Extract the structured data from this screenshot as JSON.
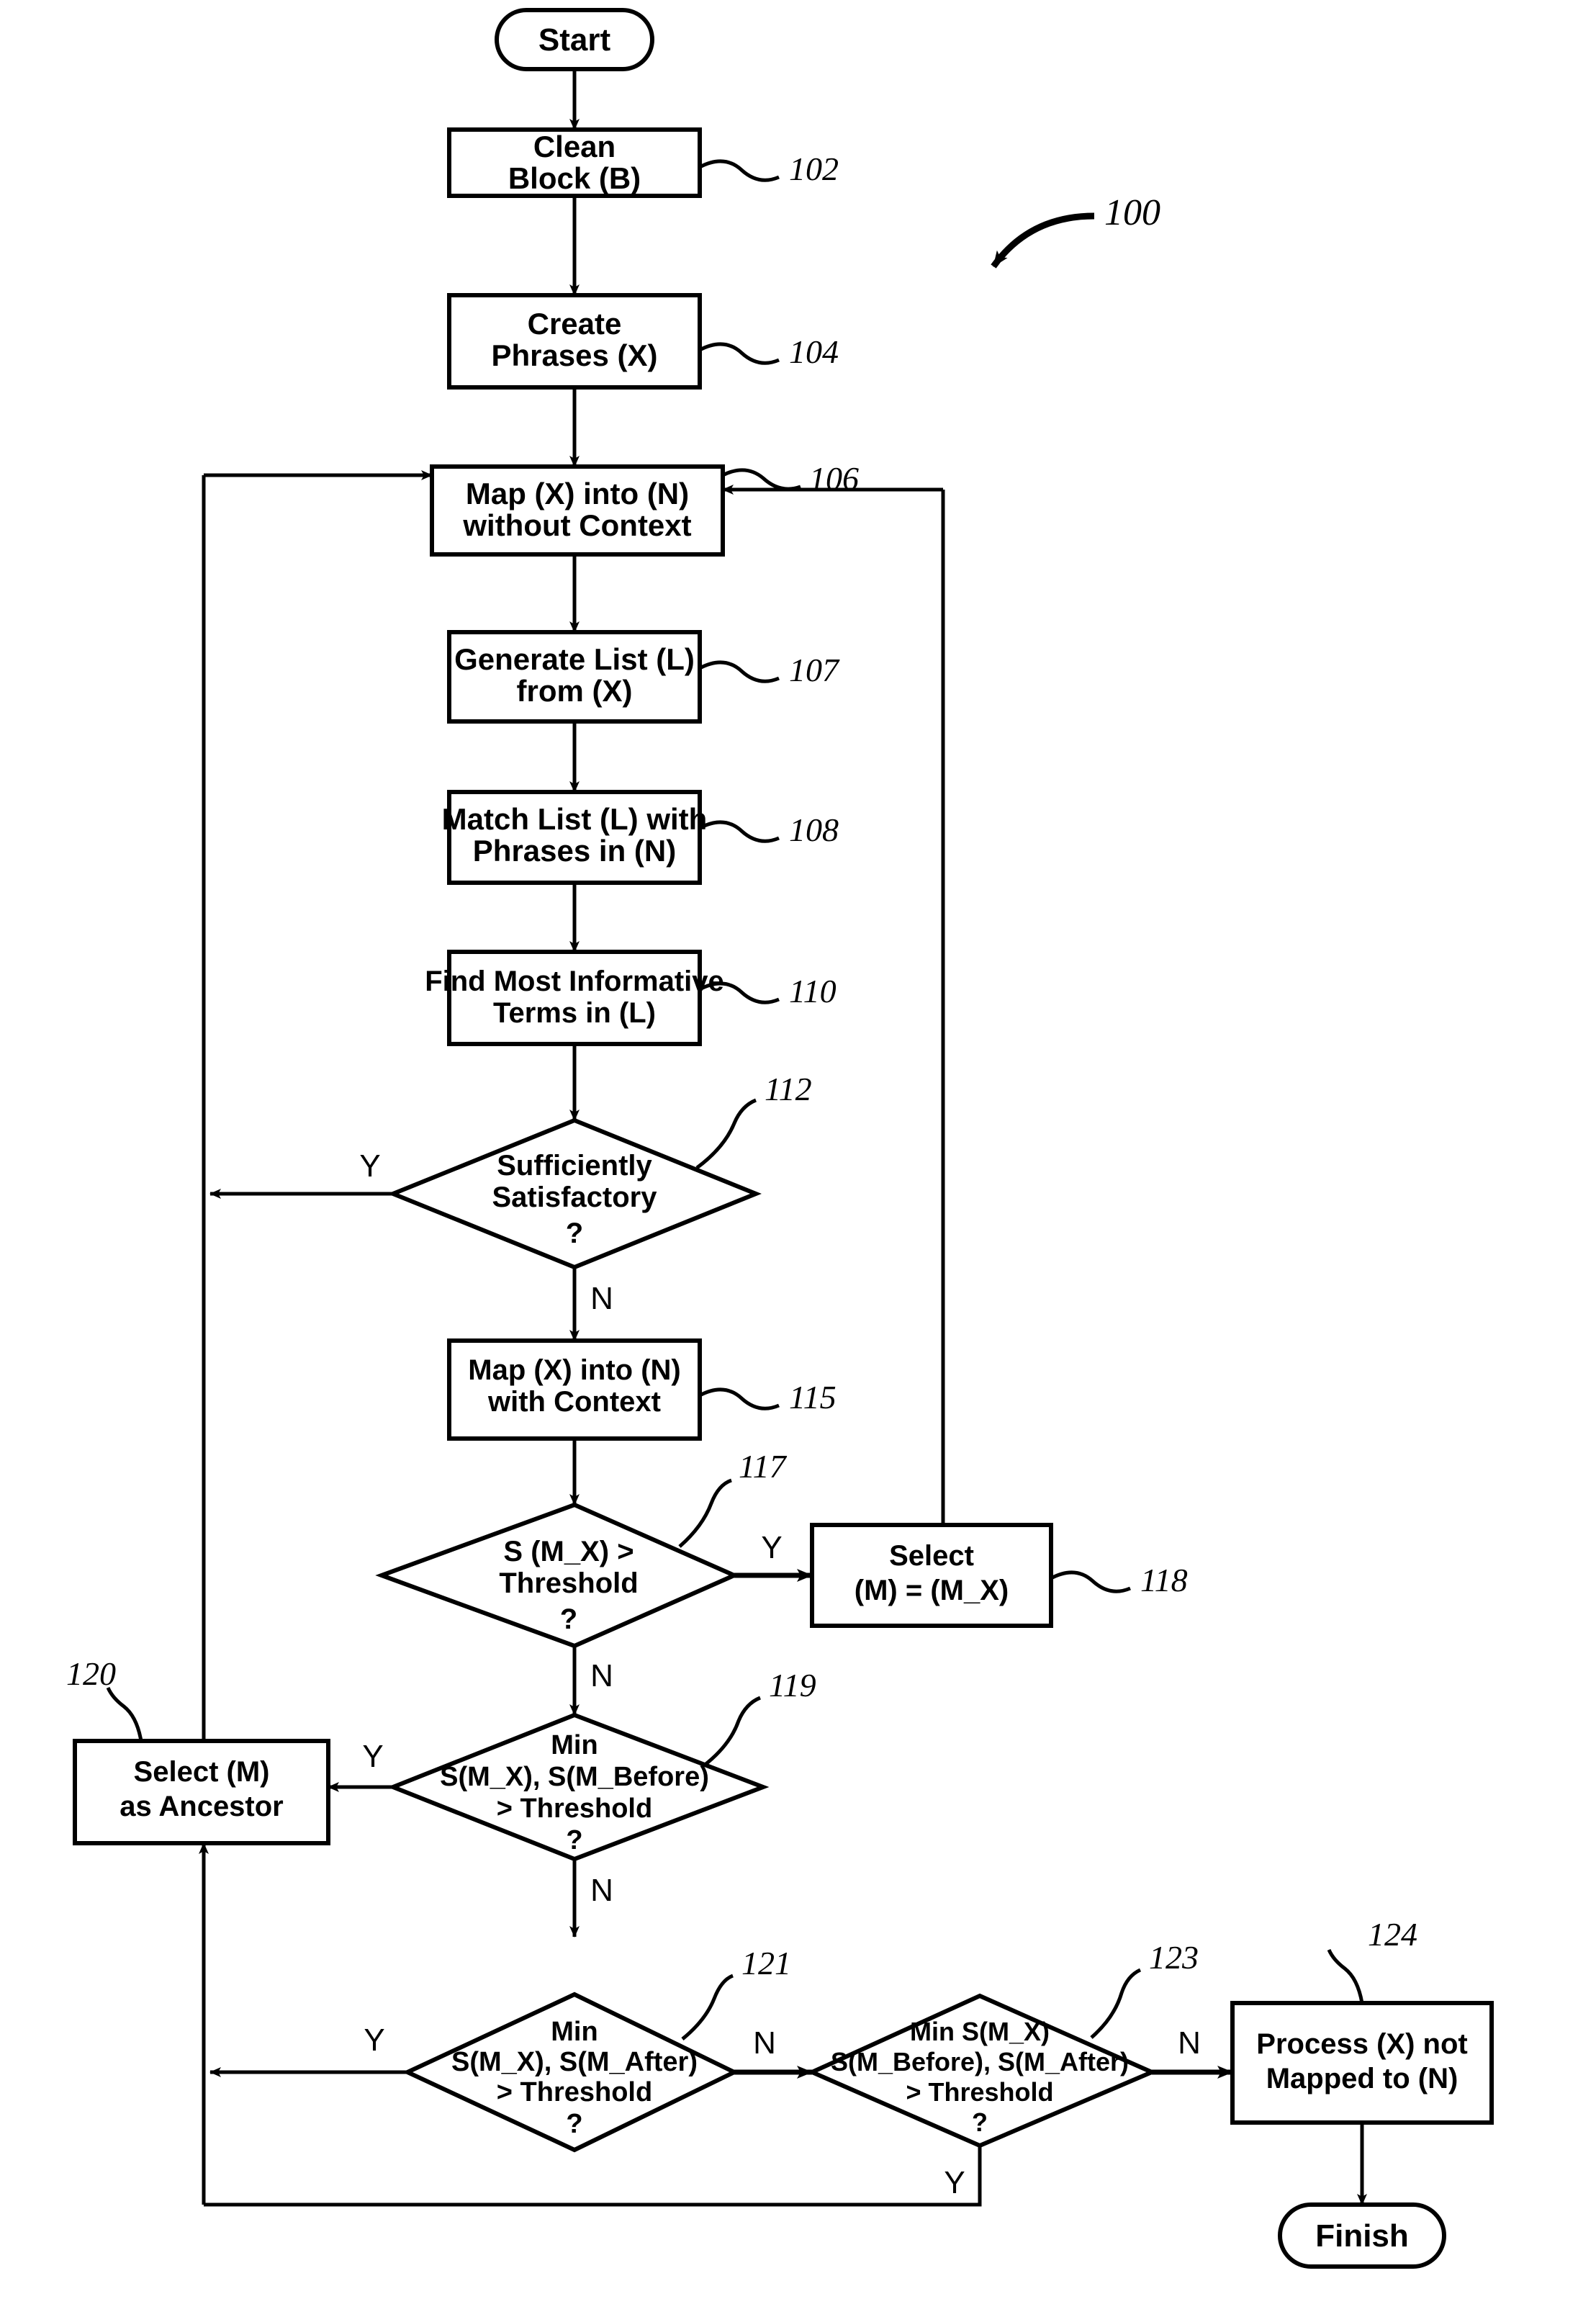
{
  "figure": {
    "reference_numeral": "100",
    "terminators": {
      "start": "Start",
      "finish": "Finish"
    },
    "nodes": [
      {
        "id": "102",
        "ref": "102",
        "type": "process",
        "lines": [
          "Clean",
          "Block (B)"
        ]
      },
      {
        "id": "104",
        "ref": "104",
        "type": "process",
        "lines": [
          "Create",
          "Phrases (X)"
        ]
      },
      {
        "id": "106",
        "ref": "106",
        "type": "process",
        "lines": [
          "Map (X) into (N)",
          "without Context"
        ]
      },
      {
        "id": "107",
        "ref": "107",
        "type": "process",
        "lines": [
          "Generate List (L)",
          "from (X)"
        ]
      },
      {
        "id": "108",
        "ref": "108",
        "type": "process",
        "lines": [
          "Match List (L) with",
          "Phrases in (N)"
        ]
      },
      {
        "id": "110",
        "ref": "110",
        "type": "process",
        "lines": [
          "Find Most Informative",
          "Terms in (L)"
        ]
      },
      {
        "id": "112",
        "ref": "112",
        "type": "decision",
        "lines": [
          "Sufficiently",
          "Satisfactory",
          "?"
        ]
      },
      {
        "id": "115",
        "ref": "115",
        "type": "process",
        "lines": [
          "Map (X) into (N)",
          "with Context"
        ]
      },
      {
        "id": "117",
        "ref": "117",
        "type": "decision",
        "lines": [
          "S (M_X) >",
          "Threshold",
          "?"
        ]
      },
      {
        "id": "118",
        "ref": "118",
        "type": "process",
        "lines": [
          "Select",
          "(M) = (M_X)"
        ]
      },
      {
        "id": "119",
        "ref": "119",
        "type": "decision",
        "lines": [
          "Min",
          "S(M_X), S(M_Before)",
          "> Threshold",
          "?"
        ]
      },
      {
        "id": "120",
        "ref": "120",
        "type": "process",
        "lines": [
          "Select (M)",
          "as Ancestor"
        ]
      },
      {
        "id": "121",
        "ref": "121",
        "type": "decision",
        "lines": [
          "Min",
          "S(M_X), S(M_After)",
          "> Threshold",
          "?"
        ]
      },
      {
        "id": "123",
        "ref": "123",
        "type": "decision",
        "lines": [
          "Min S(M_X)",
          "S(M_Before), S(M_After)",
          "> Threshold",
          "?"
        ]
      },
      {
        "id": "124",
        "ref": "124",
        "type": "process",
        "lines": [
          "Process (X) not",
          "Mapped to (N)"
        ]
      }
    ],
    "branch_labels": {
      "d112_yes": "Y",
      "d112_no": "N",
      "d117_yes": "Y",
      "d117_no": "N",
      "d119_yes": "Y",
      "d119_no": "N",
      "d121_yes": "Y",
      "d121_no": "N",
      "d123_yes": "Y",
      "d123_no": "N"
    },
    "colors": {
      "ink": "#000000",
      "paper": "#ffffff"
    }
  }
}
